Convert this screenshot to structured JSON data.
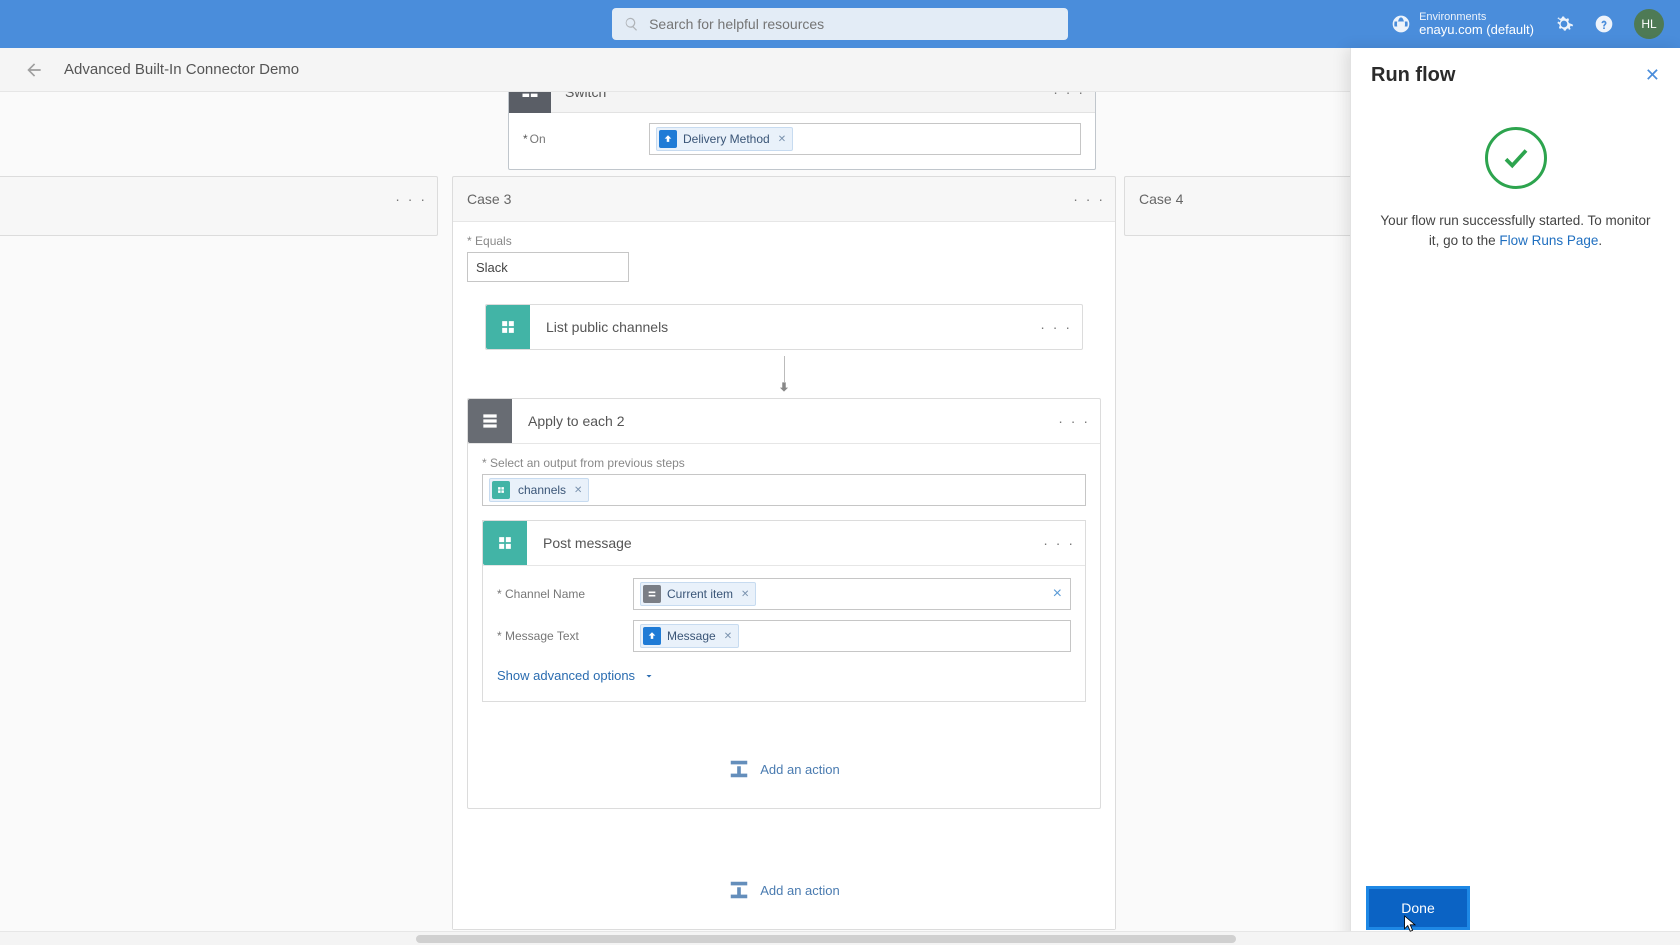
{
  "header": {
    "search_placeholder": "Search for helpful resources",
    "env_label": "Environments",
    "env_value": "enayu.com (default)",
    "avatar_initials": "HL"
  },
  "subheader": {
    "title": "Advanced Built-In Connector Demo"
  },
  "switch_card": {
    "title": "Switch",
    "on_label": "On",
    "on_token": "Delivery Method"
  },
  "cases": {
    "left_title": "",
    "mid_title": "Case 3",
    "right_title": "Case 4"
  },
  "case3": {
    "equals_label": "Equals",
    "equals_value": "Slack",
    "list_channels_title": "List public channels",
    "apply_each_title": "Apply to each 2",
    "select_output_label": "Select an output from previous steps",
    "select_output_token": "channels",
    "post_message_title": "Post message",
    "channel_name_label": "Channel Name",
    "channel_name_token": "Current item",
    "message_text_label": "Message Text",
    "message_text_token": "Message",
    "advanced_link": "Show advanced options",
    "add_action_inner": "Add an action",
    "add_action_outer": "Add an action"
  },
  "panel": {
    "title": "Run flow",
    "message_prefix": "Your flow run successfully started. To monitor it, go to the ",
    "message_link": "Flow Runs Page",
    "done_label": "Done"
  }
}
